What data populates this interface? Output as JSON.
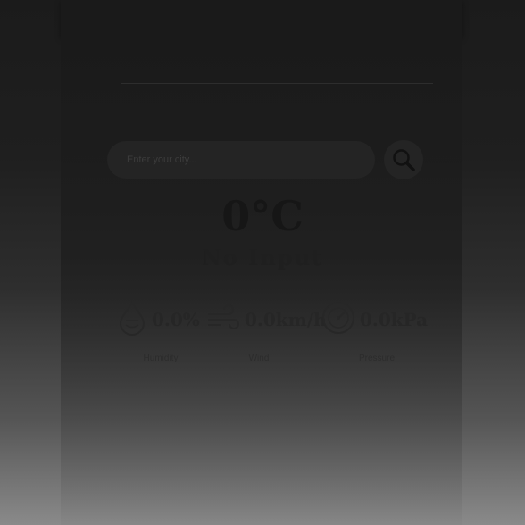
{
  "search": {
    "placeholder": "Enter your city..."
  },
  "weather": {
    "temperature": "0°C",
    "condition": "No Input"
  },
  "stats": {
    "humidity": {
      "value": "0.0%",
      "label": "Humidity"
    },
    "wind": {
      "value": "0.0km/h",
      "label": "Wind"
    },
    "pressure": {
      "value": "0.0kPa",
      "label": "Pressure"
    }
  },
  "icons": {
    "search": "search-icon",
    "humidity": "water-drop-icon",
    "wind": "wind-icon",
    "pressure": "pressure-gauge-icon"
  },
  "colors": {
    "background_top": "#1b1b1b",
    "background_bottom": "#8a8a8a",
    "panel": "#1a1a1a",
    "text": "#161616"
  }
}
